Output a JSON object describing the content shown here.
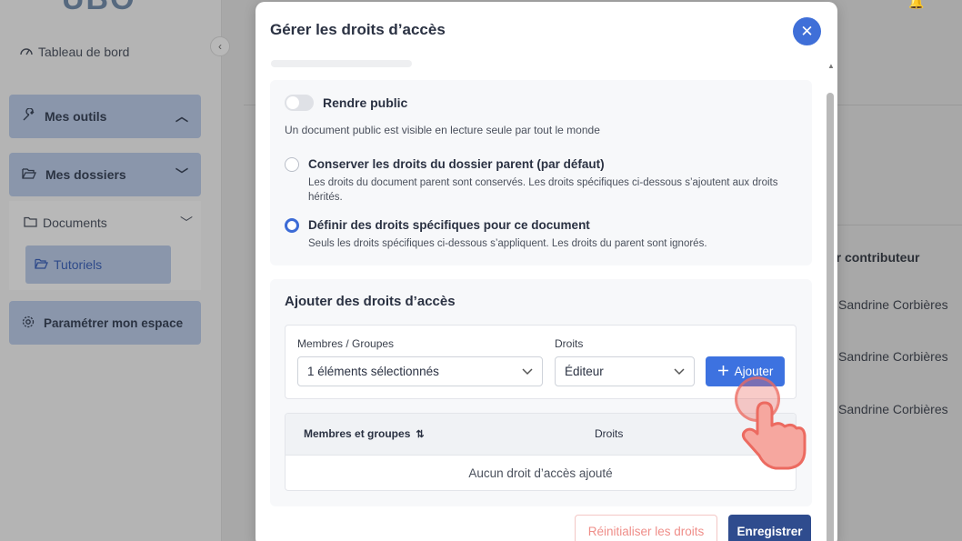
{
  "sidebar": {
    "logo": "UBO",
    "dashboard": "Tableau de bord",
    "tools": "Mes outils",
    "folders": "Mes dossiers",
    "documents": "Documents",
    "tutorials": "Tutoriels",
    "settings": "Paramétrer mon espace"
  },
  "background": {
    "contributor_header": "ier contributeur",
    "contributors": [
      "Sandrine Corbières",
      "Sandrine Corbières",
      "Sandrine Corbières"
    ]
  },
  "modal": {
    "title": "Gérer les droits d’accès",
    "public_toggle": {
      "label": "Rendre public",
      "on": false
    },
    "public_hint": "Un document public est visible en lecture seule par tout le monde",
    "options": [
      {
        "title": "Conserver les droits du dossier parent (par défaut)",
        "description": "Les droits du document parent sont conservés. Les droits spécifiques ci-dessous s’ajoutent aux droits hérités.",
        "selected": false
      },
      {
        "title": "Définir des droits spécifiques pour ce document",
        "description": "Seuls les droits spécifiques ci-dessous s’appliquent. Les droits du parent sont ignorés.",
        "selected": true
      }
    ],
    "add_section": {
      "title": "Ajouter des droits d’accès",
      "members_label": "Membres / Groupes",
      "members_value": "1 éléments sélectionnés",
      "rights_label": "Droits",
      "rights_value": "Éditeur",
      "add_button": "Ajouter"
    },
    "table": {
      "col_members": "Membres et groupes",
      "col_rights": "Droits",
      "empty": "Aucun droit d’accès ajouté"
    },
    "reset_button": "Réinitialiser les droits",
    "save_button": "Enregistrer"
  },
  "colors": {
    "primary": "#3d72e0",
    "save": "#2f4c8e",
    "reset": "#ef8e89",
    "tap": "#ec6a60"
  }
}
